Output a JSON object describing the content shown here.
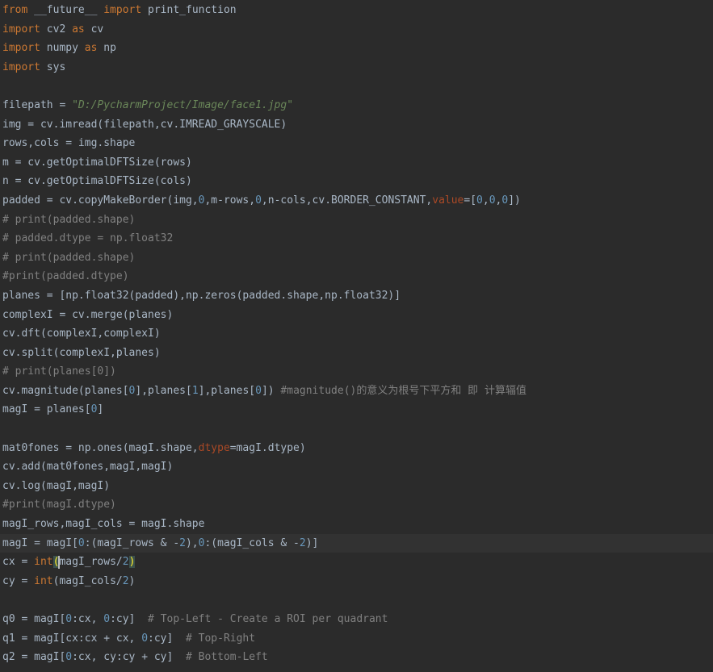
{
  "editor": {
    "lines": [
      [
        [
          "kw",
          "from "
        ],
        [
          "t",
          "__future__ "
        ],
        [
          "kw",
          "import "
        ],
        [
          "t",
          "print_function"
        ]
      ],
      [
        [
          "kw",
          "import "
        ],
        [
          "t",
          "cv2 "
        ],
        [
          "kw",
          "as "
        ],
        [
          "t",
          "cv"
        ]
      ],
      [
        [
          "kw",
          "import "
        ],
        [
          "t",
          "numpy "
        ],
        [
          "kw",
          "as "
        ],
        [
          "t",
          "np"
        ]
      ],
      [
        [
          "kw",
          "import "
        ],
        [
          "t",
          "sys"
        ]
      ],
      [],
      [
        [
          "t",
          "filepath = "
        ],
        [
          "str",
          "\"D:/PycharmProject/Image/face1.jpg\""
        ]
      ],
      [
        [
          "t",
          "img = cv.imread(filepath,cv.IMREAD_GRAYSCALE)"
        ]
      ],
      [
        [
          "t",
          "rows,cols = img.shape"
        ]
      ],
      [
        [
          "t",
          "m = cv.getOptimalDFTSize(rows)"
        ]
      ],
      [
        [
          "t",
          "n = cv.getOptimalDFTSize(cols)"
        ]
      ],
      [
        [
          "t",
          "padded = cv.copyMakeBorder(img,"
        ],
        [
          "num",
          "0"
        ],
        [
          "t",
          ",m-rows,"
        ],
        [
          "num",
          "0"
        ],
        [
          "t",
          ",n-cols,cv.BORDER_CONSTANT,"
        ],
        [
          "named",
          "value"
        ],
        [
          "t",
          "=["
        ],
        [
          "num",
          "0"
        ],
        [
          "t",
          ","
        ],
        [
          "num",
          "0"
        ],
        [
          "t",
          ","
        ],
        [
          "num",
          "0"
        ],
        [
          "t",
          "])"
        ]
      ],
      [
        [
          "cmt",
          "# print(padded.shape)"
        ]
      ],
      [
        [
          "cmt",
          "# padded.dtype = np.float32"
        ]
      ],
      [
        [
          "cmt",
          "# print(padded.shape)"
        ]
      ],
      [
        [
          "cmt",
          "#print(padded.dtype)"
        ]
      ],
      [
        [
          "t",
          "planes = [np.float32(padded),np.zeros(padded.shape,np.float32)]"
        ]
      ],
      [
        [
          "t",
          "complexI = cv.merge(planes)"
        ]
      ],
      [
        [
          "t",
          "cv.dft(complexI,complexI)"
        ]
      ],
      [
        [
          "t",
          "cv.split(complexI,planes)"
        ]
      ],
      [
        [
          "cmt",
          "# print(planes[0])"
        ]
      ],
      [
        [
          "t",
          "cv.magnitude(planes["
        ],
        [
          "num",
          "0"
        ],
        [
          "t",
          "],planes["
        ],
        [
          "num",
          "1"
        ],
        [
          "t",
          "],planes["
        ],
        [
          "num",
          "0"
        ],
        [
          "t",
          "]) "
        ],
        [
          "cmt",
          "#magnitude()的意义为根号下平方和 即 计算辐值"
        ]
      ],
      [
        [
          "t",
          "magI = planes["
        ],
        [
          "num",
          "0"
        ],
        [
          "t",
          "]"
        ]
      ],
      [],
      [
        [
          "t",
          "mat0fones = np.ones(magI.shape,"
        ],
        [
          "named",
          "dtype"
        ],
        [
          "t",
          "=magI.dtype)"
        ]
      ],
      [
        [
          "t",
          "cv.add(mat0fones,magI,magI)"
        ]
      ],
      [
        [
          "t",
          "cv.log(magI,magI)"
        ]
      ],
      [
        [
          "cmt",
          "#print(magI.dtype)"
        ]
      ],
      [
        [
          "t",
          "magI_rows,magI_cols = magI.shape"
        ]
      ],
      [
        [
          "t",
          "magI = magI["
        ],
        [
          "num",
          "0"
        ],
        [
          "t",
          ":(magI_rows & -"
        ],
        [
          "num",
          "2"
        ],
        [
          "t",
          "),"
        ],
        [
          "num",
          "0"
        ],
        [
          "t",
          ":(magI_cols & -"
        ],
        [
          "num",
          "2"
        ],
        [
          "t",
          ")]"
        ]
      ],
      [
        [
          "t",
          "cx = "
        ],
        [
          "kw",
          "int"
        ],
        [
          "hl",
          "("
        ],
        [
          "caret",
          ""
        ],
        [
          "t",
          "magI_rows/"
        ],
        [
          "num",
          "2"
        ],
        [
          "hl",
          ")"
        ]
      ],
      [
        [
          "t",
          "cy = "
        ],
        [
          "kw",
          "int"
        ],
        [
          "t",
          "(magI_cols/"
        ],
        [
          "num",
          "2"
        ],
        [
          "t",
          ")"
        ]
      ],
      [],
      [
        [
          "t",
          "q0 = magI["
        ],
        [
          "num",
          "0"
        ],
        [
          "t",
          ":cx, "
        ],
        [
          "num",
          "0"
        ],
        [
          "t",
          ":cy]  "
        ],
        [
          "cmt",
          "# Top-Left - Create a ROI per quadrant"
        ]
      ],
      [
        [
          "t",
          "q1 = magI[cx:cx + cx, "
        ],
        [
          "num",
          "0"
        ],
        [
          "t",
          ":cy]  "
        ],
        [
          "cmt",
          "# Top-Right"
        ]
      ],
      [
        [
          "t",
          "q2 = magI["
        ],
        [
          "num",
          "0"
        ],
        [
          "t",
          ":cx, cy:cy + cy]  "
        ],
        [
          "cmt",
          "# Bottom-Left"
        ]
      ]
    ],
    "current_line": 28
  },
  "colors": {
    "background": "#2b2b2b",
    "text": "#a9b7c6",
    "keyword": "#cc7832",
    "string": "#6a8759",
    "comment": "#808080",
    "number": "#6897bb",
    "named_arg": "#aa4926"
  }
}
